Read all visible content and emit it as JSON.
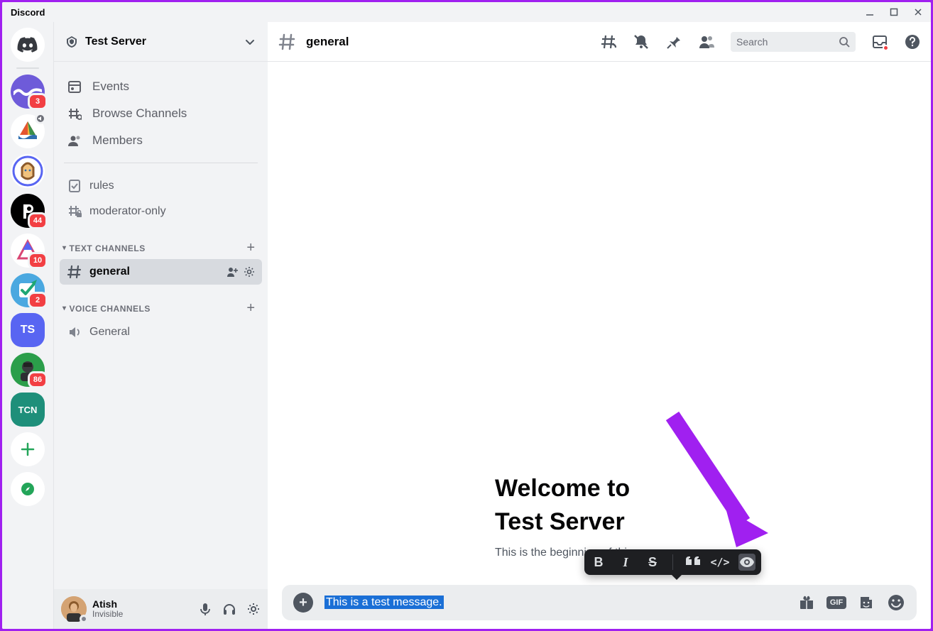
{
  "titlebar": {
    "app_name": "Discord"
  },
  "server": {
    "name": "Test Server",
    "nav": {
      "events": "Events",
      "browse": "Browse Channels",
      "members": "Members"
    },
    "channel_rules": "rules",
    "channel_mod": "moderator-only",
    "cat_text": "TEXT CHANNELS",
    "channel_general": "general",
    "cat_voice": "VOICE CHANNELS",
    "voice_general": "General"
  },
  "server_list": {
    "badge1": "3",
    "badge2": "44",
    "badge3": "10",
    "badge4": "2",
    "badge5": "86",
    "ts_label": "TS",
    "tcn_label": "TCN"
  },
  "user": {
    "name": "Atish",
    "status": "Invisible"
  },
  "header": {
    "channel": "general",
    "search_placeholder": "Search"
  },
  "welcome": {
    "line1": "Welcome to",
    "line2": "Test Server",
    "subtitle": "This is the beginning of this server."
  },
  "toolbar": {
    "bold": "B",
    "italic": "I",
    "strike": "S",
    "quote": "❝",
    "code": "</>",
    "spoiler": "◉"
  },
  "composer": {
    "text": "This is a test message.",
    "gif_label": "GIF"
  }
}
